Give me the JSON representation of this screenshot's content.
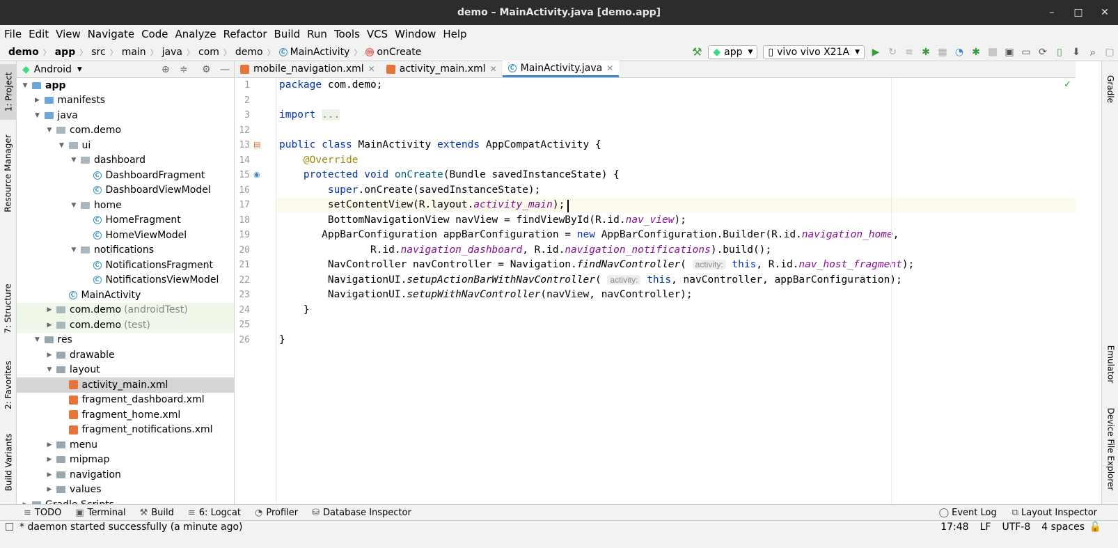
{
  "title": "demo – MainActivity.java [demo.app]",
  "window_controls": [
    "–",
    "□",
    "✕"
  ],
  "menu": [
    "File",
    "Edit",
    "View",
    "Navigate",
    "Code",
    "Analyze",
    "Refactor",
    "Build",
    "Run",
    "Tools",
    "VCS",
    "Window",
    "Help"
  ],
  "breadcrumb": [
    "demo",
    "app",
    "src",
    "main",
    "java",
    "com",
    "demo",
    "MainActivity",
    "onCreate"
  ],
  "toolbar": {
    "config": "app",
    "device": "vivo vivo X21A"
  },
  "project_panel": {
    "view": "Android"
  },
  "tree": [
    {
      "label": "app",
      "depth": 0,
      "open": true,
      "type": "folder-blue",
      "bold": true
    },
    {
      "label": "manifests",
      "depth": 1,
      "open": false,
      "type": "folder-blue"
    },
    {
      "label": "java",
      "depth": 1,
      "open": true,
      "type": "folder-blue"
    },
    {
      "label": "com.demo",
      "depth": 2,
      "open": true,
      "type": "pkg"
    },
    {
      "label": "ui",
      "depth": 3,
      "open": true,
      "type": "pkg"
    },
    {
      "label": "dashboard",
      "depth": 4,
      "open": true,
      "type": "pkg"
    },
    {
      "label": "DashboardFragment",
      "depth": 5,
      "type": "class"
    },
    {
      "label": "DashboardViewModel",
      "depth": 5,
      "type": "class"
    },
    {
      "label": "home",
      "depth": 4,
      "open": true,
      "type": "pkg"
    },
    {
      "label": "HomeFragment",
      "depth": 5,
      "type": "class"
    },
    {
      "label": "HomeViewModel",
      "depth": 5,
      "type": "class"
    },
    {
      "label": "notifications",
      "depth": 4,
      "open": true,
      "type": "pkg"
    },
    {
      "label": "NotificationsFragment",
      "depth": 5,
      "type": "class"
    },
    {
      "label": "NotificationsViewModel",
      "depth": 5,
      "type": "class"
    },
    {
      "label": "MainActivity",
      "depth": 3,
      "type": "class"
    },
    {
      "label": "com.demo",
      "suffix": "(androidTest)",
      "depth": 2,
      "open": false,
      "type": "pkg",
      "test": true
    },
    {
      "label": "com.demo",
      "suffix": "(test)",
      "depth": 2,
      "open": false,
      "type": "pkg",
      "test": true
    },
    {
      "label": "res",
      "depth": 1,
      "open": true,
      "type": "folder"
    },
    {
      "label": "drawable",
      "depth": 2,
      "open": false,
      "type": "folder"
    },
    {
      "label": "layout",
      "depth": 2,
      "open": true,
      "type": "folder"
    },
    {
      "label": "activity_main.xml",
      "depth": 3,
      "type": "xml",
      "selected": true
    },
    {
      "label": "fragment_dashboard.xml",
      "depth": 3,
      "type": "xml"
    },
    {
      "label": "fragment_home.xml",
      "depth": 3,
      "type": "xml"
    },
    {
      "label": "fragment_notifications.xml",
      "depth": 3,
      "type": "xml"
    },
    {
      "label": "menu",
      "depth": 2,
      "open": false,
      "type": "folder"
    },
    {
      "label": "mipmap",
      "depth": 2,
      "open": false,
      "type": "folder"
    },
    {
      "label": "navigation",
      "depth": 2,
      "open": false,
      "type": "folder"
    },
    {
      "label": "values",
      "depth": 2,
      "open": false,
      "type": "folder"
    },
    {
      "label": "Gradle Scripts",
      "depth": 0,
      "open": false,
      "type": "folder"
    }
  ],
  "editor_tabs": [
    {
      "label": "mobile_navigation.xml",
      "type": "xml"
    },
    {
      "label": "activity_main.xml",
      "type": "xml"
    },
    {
      "label": "MainActivity.java",
      "type": "class",
      "active": true
    }
  ],
  "line_numbers": [
    "1",
    "2",
    "3",
    "12",
    "13",
    "14",
    "15",
    "16",
    "17",
    "18",
    "19",
    "20",
    "21",
    "22",
    "23",
    "24",
    "25",
    "26"
  ],
  "left_tools": [
    "1: Project",
    "Resource Manager",
    "7: Structure",
    "2: Favorites",
    "Build Variants"
  ],
  "right_tools": [
    "Gradle",
    "Emulator",
    "Device File Explorer"
  ],
  "bottom_tabs": [
    {
      "icon": "≡",
      "label": "TODO"
    },
    {
      "icon": "▣",
      "label": "Terminal"
    },
    {
      "icon": "⚒",
      "label": "Build"
    },
    {
      "icon": "≡",
      "label": "6: Logcat"
    },
    {
      "icon": "◔",
      "label": "Profiler"
    },
    {
      "icon": "⛁",
      "label": "Database Inspector"
    }
  ],
  "bottom_right": [
    "Event Log",
    "Layout Inspector"
  ],
  "status": {
    "message": "* daemon started successfully (a minute ago)",
    "position": "17:48",
    "line_sep": "LF",
    "encoding": "UTF-8",
    "indent": "4 spaces"
  },
  "colors": {
    "keyword": "#0033b3",
    "annotation": "#9e880d",
    "field": "#871094",
    "accent": "#4083c9"
  }
}
